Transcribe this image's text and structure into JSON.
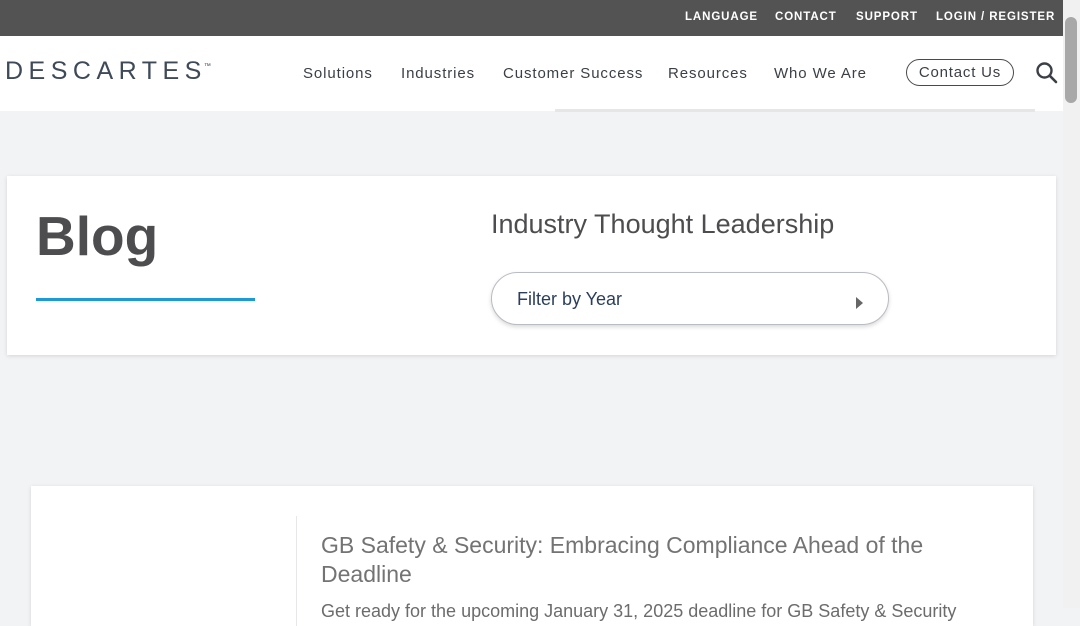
{
  "utility_nav": {
    "language": "LANGUAGE",
    "contact": "CONTACT",
    "support": "SUPPORT",
    "login_register": "LOGIN / REGISTER"
  },
  "logo": {
    "text": "DESCARTES",
    "trademark": "™"
  },
  "main_nav": {
    "items": [
      "Solutions",
      "Industries",
      "Customer Success",
      "Resources",
      "Who We Are"
    ],
    "contact_button": "Contact Us",
    "search_icon": "search-icon"
  },
  "hero": {
    "title": "Blog",
    "subtitle": "Industry Thought Leadership",
    "filter_placeholder": "Filter by Year",
    "underline_color": "#1a9bd7"
  },
  "posts": [
    {
      "title": "GB Safety & Security: Embracing Compliance Ahead of the Deadline",
      "excerpt": "Get ready for the upcoming January 31, 2025 deadline for GB Safety & Security"
    }
  ],
  "colors": {
    "utility_bar": "#535353",
    "accent": "#1a9bd7",
    "logo": "#3f4a58",
    "page_background": "#f2f3f5"
  }
}
